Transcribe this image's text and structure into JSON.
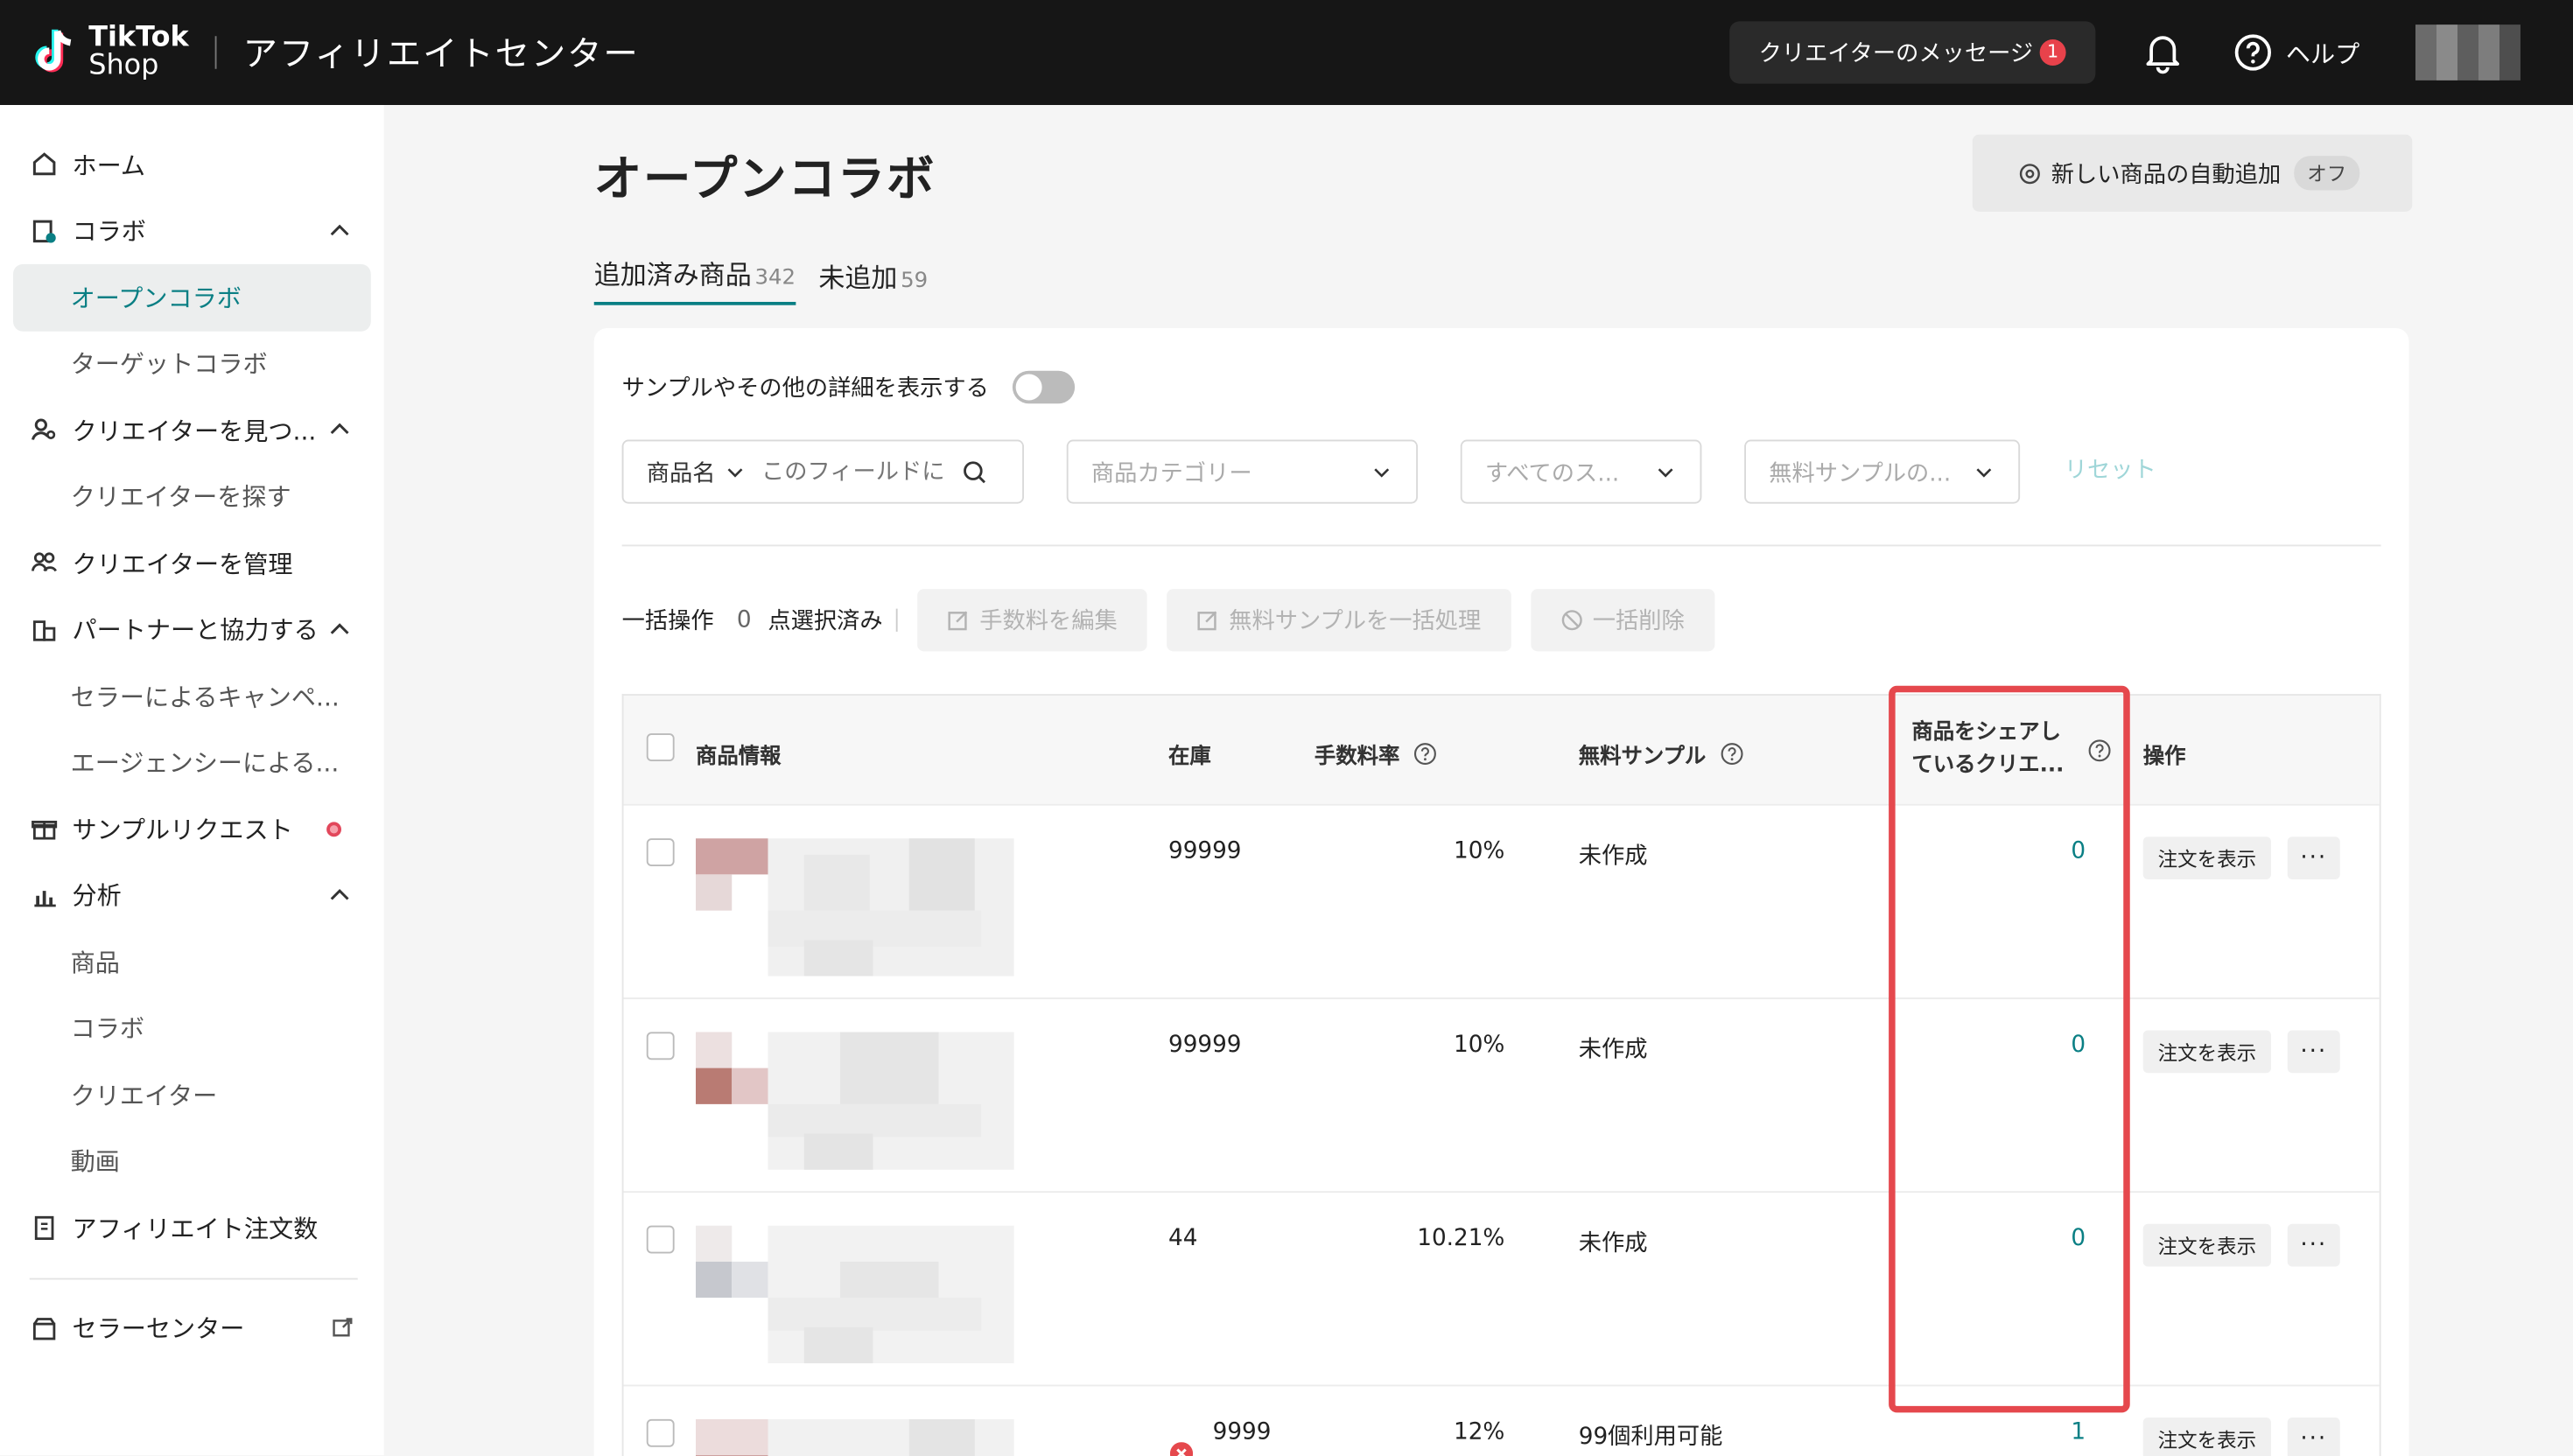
{
  "header": {
    "brand_top": "TikTok",
    "brand_bottom": "Shop",
    "app_title": "アフィリエイトセンター",
    "messages_label": "クリエイターのメッセージ",
    "messages_count": "1",
    "help_label": "ヘルプ",
    "colors": {
      "bar": "#161616",
      "accent": "#0a7f84",
      "alert": "#e8424b"
    }
  },
  "sidebar": {
    "items": [
      {
        "label": "ホーム",
        "icon": "home-icon"
      },
      {
        "label": "コラボ",
        "icon": "collab-icon"
      },
      {
        "label": "オープンコラボ"
      },
      {
        "label": "ターゲットコラボ"
      },
      {
        "label": "クリエイターを見つ...",
        "icon": "find-creator-icon"
      },
      {
        "label": "クリエイターを探す"
      },
      {
        "label": "クリエイターを管理",
        "icon": "manage-creator-icon"
      },
      {
        "label": "パートナーと協力する",
        "icon": "partner-icon"
      },
      {
        "label": "セラーによるキャンペ..."
      },
      {
        "label": "エージェンシーによる..."
      },
      {
        "label": "サンプルリクエスト",
        "icon": "gift-icon"
      },
      {
        "label": "分析",
        "icon": "analytics-icon"
      },
      {
        "label": "商品"
      },
      {
        "label": "コラボ"
      },
      {
        "label": "クリエイター"
      },
      {
        "label": "動画"
      },
      {
        "label": "アフィリエイト注文数",
        "icon": "clipboard-icon"
      },
      {
        "label": "セラーセンター",
        "icon": "store-icon"
      }
    ]
  },
  "page": {
    "title": "オープンコラボ",
    "auto_add_label": "新しい商品の自動追加",
    "auto_add_state": "オフ",
    "tabs": [
      {
        "label": "追加済み商品",
        "count": "342"
      },
      {
        "label": "未追加",
        "count": "59"
      }
    ],
    "details_toggle_label": "サンプルやその他の詳細を表示する",
    "filters": {
      "product_name_select": "商品名",
      "search_placeholder": "このフィールドに",
      "category_placeholder": "商品カテゴリー",
      "status_placeholder": "すべてのス...",
      "sample_placeholder": "無料サンプルの...",
      "reset_label": "リセット"
    },
    "bulk": {
      "label": "一括操作",
      "selected_count": "0",
      "selected_suffix": "点選択済み",
      "edit_commission": "手数料を編集",
      "bulk_sample": "無料サンプルを一括処理",
      "bulk_delete": "一括削除"
    },
    "table": {
      "columns": {
        "product_info": "商品情報",
        "stock": "在庫",
        "commission": "手数料率",
        "free_sample": "無料サンプル",
        "sharing_creators_line1": "商品をシェアし",
        "sharing_creators_line2": "ているクリエ...",
        "actions": "操作"
      },
      "rows": [
        {
          "stock": "99999",
          "commission": "10%",
          "sample": "未作成",
          "creators": "0",
          "view": "注文を表示",
          "more": "···"
        },
        {
          "stock": "99999",
          "commission": "10%",
          "sample": "未作成",
          "creators": "0",
          "view": "注文を表示",
          "more": "···"
        },
        {
          "stock": "44",
          "commission": "10.21%",
          "sample": "未作成",
          "creators": "0",
          "view": "注文を表示",
          "more": "···"
        },
        {
          "stock": "9999",
          "commission": "12%",
          "sample": "99個利用可能",
          "creators": "1",
          "view": "注文を表示",
          "more": "···"
        }
      ]
    }
  }
}
